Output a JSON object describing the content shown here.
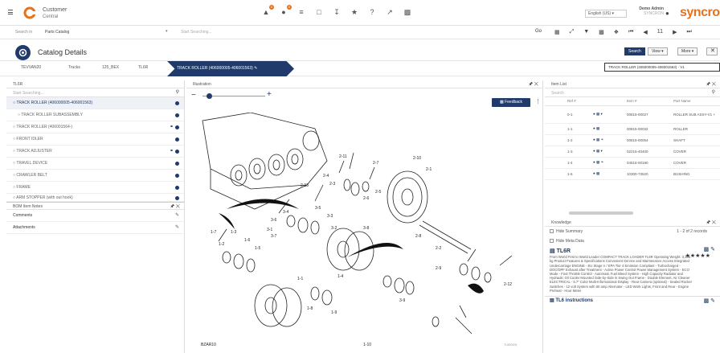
{
  "app": {
    "name": "Customer",
    "sub": "Central",
    "brand": "syncron"
  },
  "topbar": {
    "language": "English (US)",
    "user_name": "Demo Admin",
    "user_sub": "SYNCRON",
    "badge1": "0",
    "badge2": "0"
  },
  "search": {
    "label": "Search in",
    "catalog": "Parts Catalog",
    "placeholder": "Start Searching...",
    "go": "Go",
    "page": "11"
  },
  "catalog": {
    "title": "Catalog Details",
    "search_btn": "Search",
    "view_btn": "View",
    "more_btn": "More"
  },
  "breadcrumbs": [
    "TEVVAN20",
    "Trucks",
    "125_BEX",
    "TL6R"
  ],
  "breadcrumb_active": "TRACK ROLLER (406000005-406001563)",
  "track_box": "TRACK ROLLER (406000005-406001563) - V1",
  "tree": {
    "title": "TL6R",
    "search_placeholder": "Start Searching...",
    "items": [
      {
        "label": "TRACK ROLLER (406000005-406001563)",
        "selected": true
      },
      {
        "label": "TRACK ROLLER SUBASSEMBLY",
        "selected": false
      },
      {
        "label": "TRACK ROLLER (406001564-)",
        "selected": false
      },
      {
        "label": "FRONT IDLER",
        "selected": false
      },
      {
        "label": "TRACK ADJUSTER",
        "selected": false
      },
      {
        "label": "TRAVEL DEVICE",
        "selected": false
      },
      {
        "label": "CRAWLER BELT",
        "selected": false
      },
      {
        "label": "FRAME",
        "selected": false
      },
      {
        "label": "ARM STOPPER (with out hook)",
        "selected": false
      }
    ]
  },
  "bom": {
    "title": "BOM Item Notes",
    "rows": [
      "Comments",
      "Attachments"
    ]
  },
  "illustration": {
    "title": "Illustration",
    "feedback": "Feedback",
    "footer_id": "TL6R0009",
    "footer_right": "BZAR10",
    "callouts": [
      "2-10",
      "2-1",
      "2-7",
      "2-11",
      "2-4",
      "2-3",
      "2-13",
      "2-6",
      "2-5",
      "2-12",
      "3-6",
      "3-4",
      "3-5",
      "3-3",
      "3-2",
      "3-7",
      "3-1",
      "3-8",
      "1-7",
      "1-2",
      "1-3",
      "1-6",
      "1-5",
      "1-4",
      "1-1",
      "1-8",
      "1-9",
      "2-8",
      "2-9",
      "2-2",
      "3-9",
      "1-10"
    ]
  },
  "item_list": {
    "title": "Item List",
    "search_placeholder": "Search",
    "headers": [
      "Ref #",
      "",
      "Item #",
      "Part Name"
    ],
    "rows": [
      {
        "ref": "0-1",
        "item": "00815-00027",
        "name": "ROLLER SUB ASSY-V1 +"
      },
      {
        "ref": "1-1",
        "item": "00815-00032",
        "name": "ROLLER"
      },
      {
        "ref": "1-2",
        "item": "00815-00054",
        "name": "SHAFT"
      },
      {
        "ref": "1-3",
        "item": "02215-40400",
        "name": "COVER"
      },
      {
        "ref": "1-4",
        "item": "04515-00190",
        "name": "COVER"
      },
      {
        "ref": "1-6",
        "item": "10300-73520",
        "name": "BUSHING"
      }
    ]
  },
  "knowledge": {
    "title": "Knowledge",
    "hide_summary": "Hide Summary",
    "hide_meta": "Hide Meta Data",
    "records": "1 - 2 of 2 records",
    "card_title": "TL6R",
    "card_text": "From World First to World Leader COMPACT TRACK LOADER TL6R Operating Weight: 3,395 kg Product Features & Specifications Convenient Service and Maintenance Access Integrated Undercarriage ENGINE - EU Stage V / EPA Tier 4 Emission Compliant - Turbocharged - DOC/DPF Exhaust after Treatment - Active Power Control Power Management System - ECO Mode - Foot Throttle Control - Automatic Fuel Bleed System - High Capacity Radiator and Hydraulic Oil Cooler Mounted Side-by-Side in Swing Out Frame - Double Element, Air Cleaner ELECTRICAL - 5.7\" Color Multi-Informational Display - Rear Camera (optional) - Sealed Rocker Switches - 12 volt System with 60 amp Alternator - LED Work Lights, Front and Rear - Engine Preheat - Hour Meter",
    "card2_title": "TL6 instructions"
  }
}
